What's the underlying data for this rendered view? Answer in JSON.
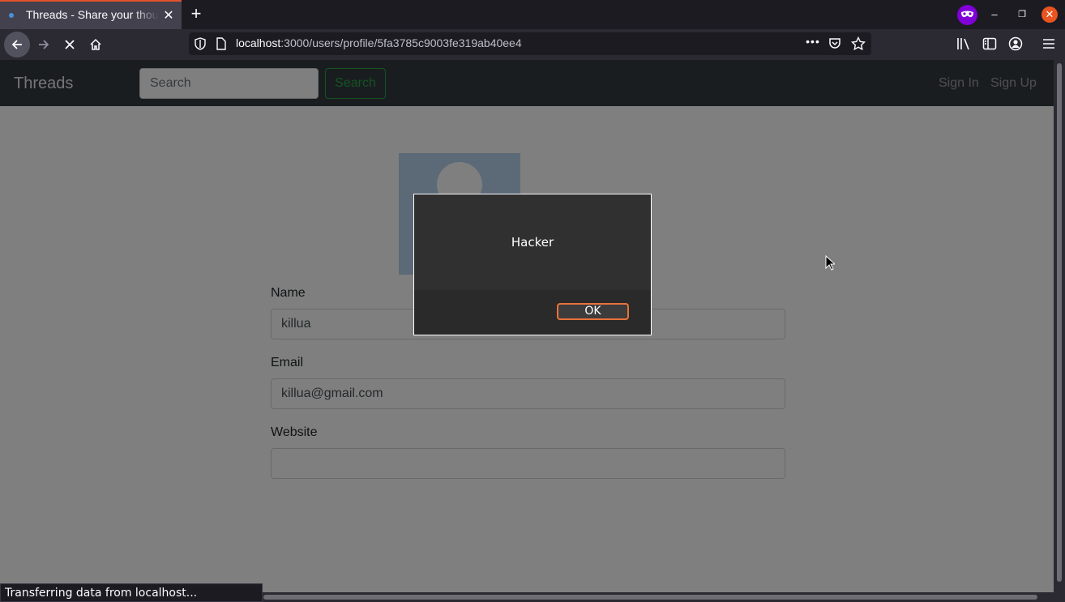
{
  "browser": {
    "tab_title": "Threads - Share your thoughts",
    "tab_close": "✕",
    "new_tab": "+",
    "url_host": "localhost",
    "url_path": ":3000/users/profile/5fa3785c9003fe319ab40ee4",
    "url_more": "•••",
    "status_text": "Transferring data from localhost...",
    "window_controls": {
      "minimize": "–",
      "restore": "❐",
      "close": "✕"
    },
    "accent_color": "#e2522a",
    "private_badge_color": "#8000d7"
  },
  "site": {
    "brand": "Threads",
    "search_placeholder": "Search",
    "search_button": "Search",
    "sign_in": "Sign In",
    "sign_up": "Sign Up",
    "button_color": "#28a745"
  },
  "profile": {
    "name_label": "Name",
    "name_value": "killua",
    "email_label": "Email",
    "email_value": "killua@gmail.com",
    "website_label": "Website",
    "website_value": ""
  },
  "alert": {
    "message": "Hacker",
    "ok_label": "OK"
  }
}
